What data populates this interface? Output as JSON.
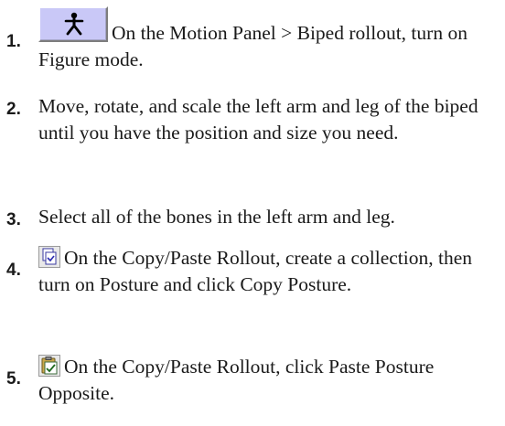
{
  "steps": [
    {
      "number": "1.",
      "icon": "biped-figure-mode-icon",
      "text": "On the Motion Panel > Biped rollout, turn on Figure mode."
    },
    {
      "number": "2.",
      "text": "Move, rotate, and scale the left arm and leg of the biped until you have the position and size you need."
    },
    {
      "number": "3.",
      "text": "Select all of the bones in the left arm and leg."
    },
    {
      "number": "4.",
      "icon": "copy-posture-icon",
      "text": "On the Copy/Paste Rollout, create a collection, then turn on Posture and click Copy Posture."
    },
    {
      "number": "5.",
      "icon": "paste-posture-opposite-icon",
      "text": "On the Copy/Paste Rollout, click Paste Posture Opposite."
    }
  ],
  "colors": {
    "figure_button_bg": "#c9c8f7",
    "text": "#1a1a1a"
  }
}
